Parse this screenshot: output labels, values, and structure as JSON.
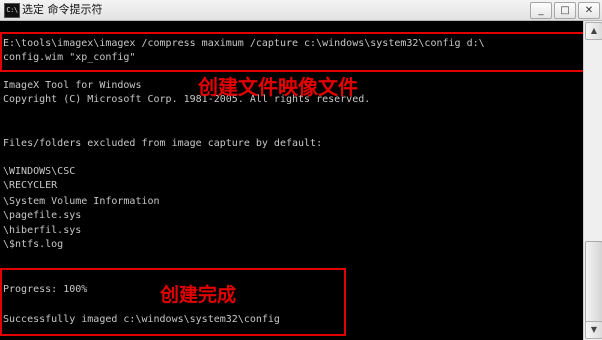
{
  "window": {
    "icon_text": "C:\\",
    "title": "选定 命令提示符",
    "buttons": {
      "minimize": "_",
      "maximize": "□",
      "close": "✕"
    }
  },
  "console": {
    "lines": [
      "E:\\tools\\imagex\\imagex /compress maximum /capture c:\\windows\\system32\\config d:\\",
      "config.wim \"xp_config\"",
      "ImageX Tool for Windows",
      "Copyright (C) Microsoft Corp. 1981-2005. All rights reserved.",
      "Files/folders excluded from image capture by default:",
      "\\WINDOWS\\CSC",
      "\\RECYCLER",
      "\\System Volume Information",
      "\\pagefile.sys",
      "\\hiberfil.sys",
      "\\$ntfs.log",
      "Progress: 100%",
      "Successfully imaged c:\\windows\\system32\\config"
    ]
  },
  "annotations": {
    "create_image_label": "创建文件映像文件",
    "create_done_label": "创建完成"
  },
  "scrollbar": {
    "up_arrow": "▲",
    "down_arrow": "▼"
  },
  "colors": {
    "console_bg": "#000000",
    "console_text": "#c8c8c8",
    "annotation_red": "#e30000"
  }
}
